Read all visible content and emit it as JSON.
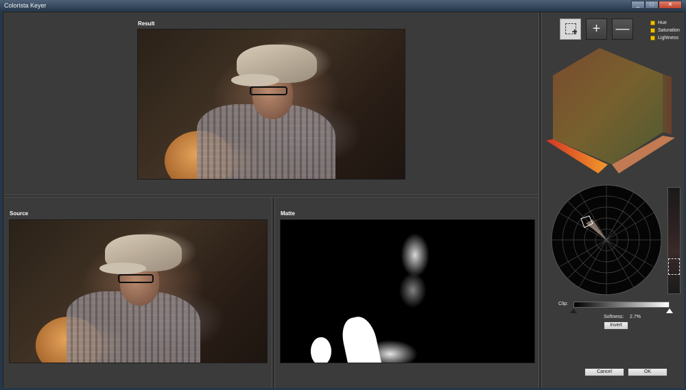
{
  "window": {
    "title": "Colorista Keyer",
    "controls": [
      "_",
      "□",
      "✕"
    ]
  },
  "panels": {
    "result_label": "Result",
    "source_label": "Source",
    "matte_label": "Matte"
  },
  "keyer": {
    "tools": [
      {
        "name": "add-region-picker",
        "active": true
      },
      {
        "name": "add",
        "glyph": "+"
      },
      {
        "name": "subtract",
        "glyph": "—"
      }
    ],
    "channels": [
      {
        "label": "Hue",
        "checked": true
      },
      {
        "label": "Saturation",
        "checked": true
      },
      {
        "label": "Lightness",
        "checked": true
      }
    ],
    "clip_label": "Clip:",
    "softness_label": "Softness:",
    "softness_value": "2.7%",
    "invert_label": "Invert",
    "cancel_label": "Cancel",
    "ok_label": "OK"
  },
  "colors": {
    "panel_bg": "#3b3b3b",
    "checkbox": "#f2c200",
    "cube_warm": "#c0542b"
  }
}
